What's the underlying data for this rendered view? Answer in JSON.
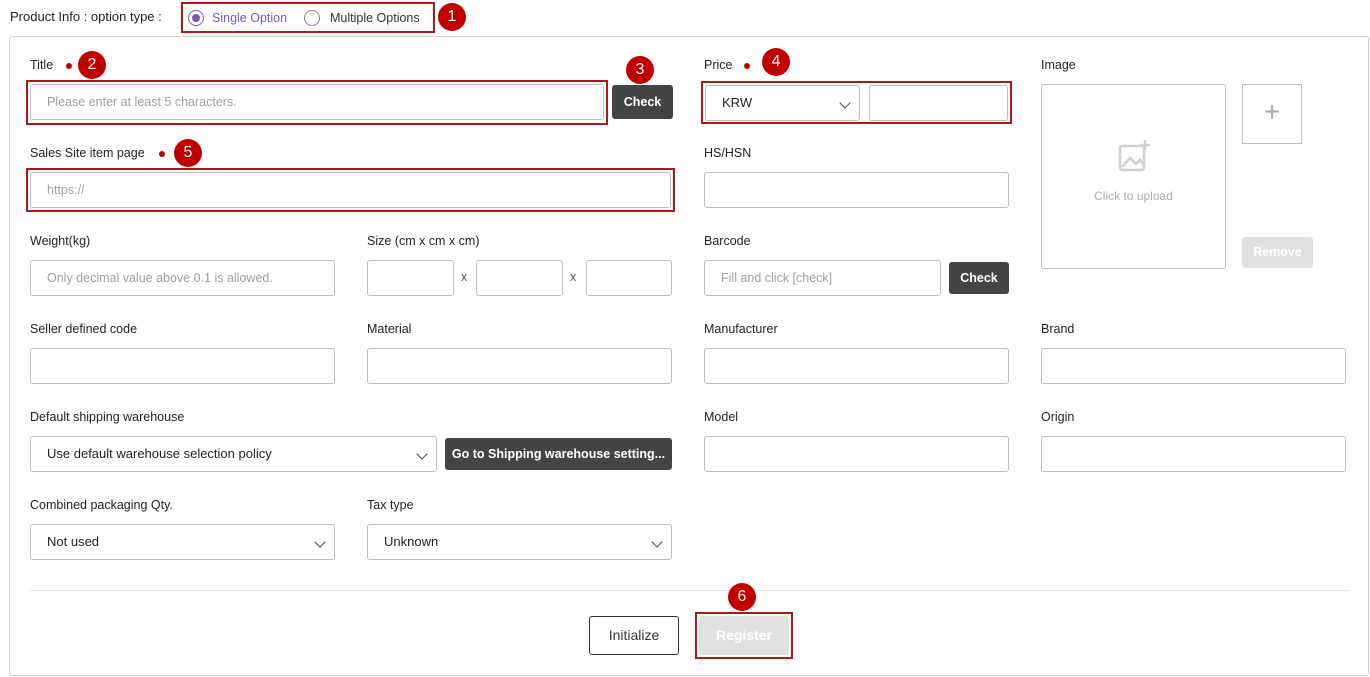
{
  "option_type": {
    "label": "Product Info : option type :",
    "single": "Single Option",
    "multiple": "Multiple Options",
    "selected": "Single Option"
  },
  "badges": [
    "1",
    "2",
    "3",
    "4",
    "5",
    "6"
  ],
  "fields": {
    "title": {
      "label": "Title",
      "placeholder": "Please enter at least 5 characters.",
      "check": "Check"
    },
    "price": {
      "label": "Price",
      "currency": "KRW",
      "value": ""
    },
    "image": {
      "label": "Image",
      "upload_text": "Click to upload",
      "remove": "Remove",
      "plus": "+"
    },
    "sales_site": {
      "label": "Sales Site item page",
      "placeholder": "https://"
    },
    "hs_hsn": {
      "label": "HS/HSN"
    },
    "weight": {
      "label": "Weight(kg)",
      "placeholder": "Only decimal value above 0.1 is allowed."
    },
    "size": {
      "label": "Size (cm x cm x cm)",
      "sep": "x"
    },
    "barcode": {
      "label": "Barcode",
      "placeholder": "Fill and click [check]",
      "check": "Check"
    },
    "seller_code": {
      "label": "Seller defined code"
    },
    "material": {
      "label": "Material"
    },
    "manufacturer": {
      "label": "Manufacturer"
    },
    "brand": {
      "label": "Brand"
    },
    "warehouse": {
      "label": "Default shipping warehouse",
      "value": "Use default warehouse selection policy",
      "goto": "Go to Shipping warehouse setting..."
    },
    "model": {
      "label": "Model"
    },
    "origin": {
      "label": "Origin"
    },
    "packaging": {
      "label": "Combined packaging Qty.",
      "value": "Not used"
    },
    "tax": {
      "label": "Tax type",
      "value": "Unknown"
    }
  },
  "actions": {
    "initialize": "Initialize",
    "register": "Register"
  },
  "colors": {
    "accent": "#7e57c2",
    "highlight": "#b01818",
    "badge": "#c00000",
    "dark_button": "#444444"
  }
}
